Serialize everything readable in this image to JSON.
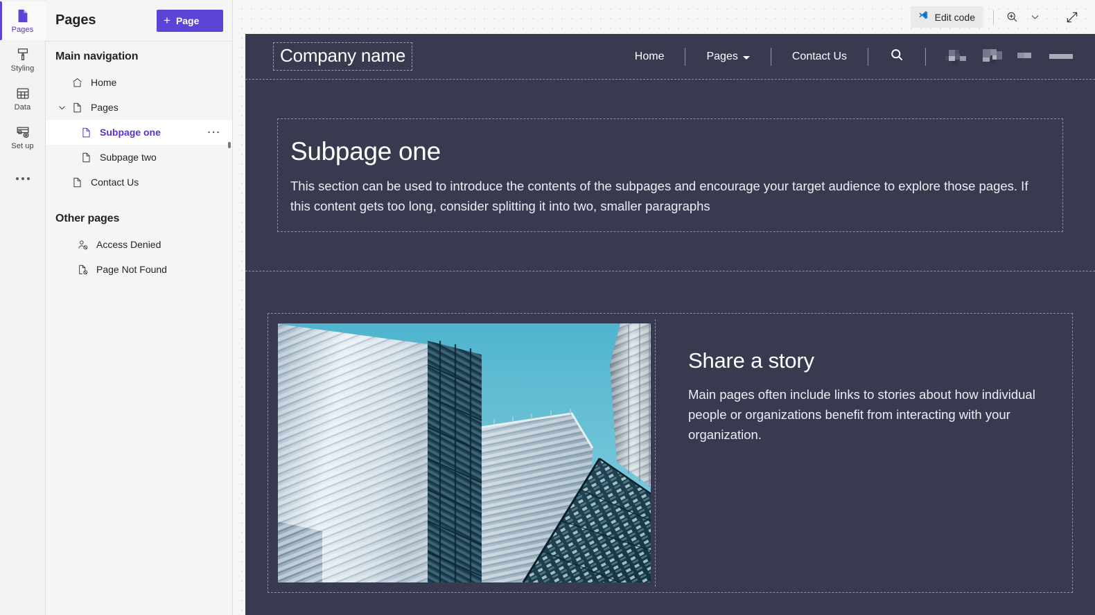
{
  "rail": {
    "items": [
      {
        "label": "Pages",
        "icon": "pages-icon",
        "active": true
      },
      {
        "label": "Styling",
        "icon": "brush-icon",
        "active": false
      },
      {
        "label": "Data",
        "icon": "table-icon",
        "active": false
      },
      {
        "label": "Set up",
        "icon": "setup-icon",
        "active": false
      }
    ],
    "more_label": "More options",
    "more_icon": "ellipsis-icon"
  },
  "panel": {
    "title": "Pages",
    "add_button": {
      "label": "Page",
      "plus": "+",
      "icon": "plus-icon"
    },
    "groups": [
      {
        "title": "Main navigation",
        "items": [
          {
            "label": "Home",
            "icon": "home-icon",
            "indent": 0,
            "expandable": false,
            "selected": false
          },
          {
            "label": "Pages",
            "icon": "page-icon",
            "indent": 0,
            "expandable": true,
            "expanded": true,
            "selected": false
          },
          {
            "label": "Subpage one",
            "icon": "page-icon",
            "indent": 1,
            "expandable": false,
            "selected": true,
            "more": "···"
          },
          {
            "label": "Subpage two",
            "icon": "page-icon",
            "indent": 1,
            "expandable": false,
            "selected": false
          },
          {
            "label": "Contact Us",
            "icon": "page-icon",
            "indent": 0,
            "expandable": false,
            "selected": false
          }
        ]
      },
      {
        "title": "Other pages",
        "items": [
          {
            "label": "Access Denied",
            "icon": "person-blocked-icon",
            "indent": 0,
            "expandable": false,
            "selected": false
          },
          {
            "label": "Page Not Found",
            "icon": "page-blocked-icon",
            "indent": 0,
            "expandable": false,
            "selected": false
          }
        ]
      }
    ]
  },
  "toolbar": {
    "edit_code_label": "Edit code",
    "edit_code_icon": "vscode-icon",
    "zoom_in_icon": "zoom-in-icon",
    "zoom_chevron_icon": "chevron-down-icon",
    "expand_icon": "expand-diagonal-icon"
  },
  "site": {
    "brand": "Company name",
    "nav": [
      {
        "label": "Home",
        "dropdown": false
      },
      {
        "label": "Pages",
        "dropdown": true
      },
      {
        "label": "Contact Us",
        "dropdown": false
      }
    ],
    "search_icon": "search-icon",
    "redacted_label": "redacted-content",
    "hero": {
      "heading": "Subpage one",
      "paragraph": "This section can be used to introduce the contents of the subpages and encourage your target audience to explore those pages. If this content gets too long, consider splitting it into two, smaller paragraphs"
    },
    "story": {
      "image_alt": "Looking up at glass skyscrapers against a blue sky",
      "heading": "Share a story",
      "paragraph": "Main pages often include links to stories about how individual people or organizations benefit from interacting with your organization."
    }
  },
  "colors": {
    "accent": "#5b45d6",
    "accent_text": "#5b2fd1",
    "site_bg": "#383b4f",
    "panel_bg": "#f5f5f5",
    "canvas_bg": "#f7f6f5"
  }
}
